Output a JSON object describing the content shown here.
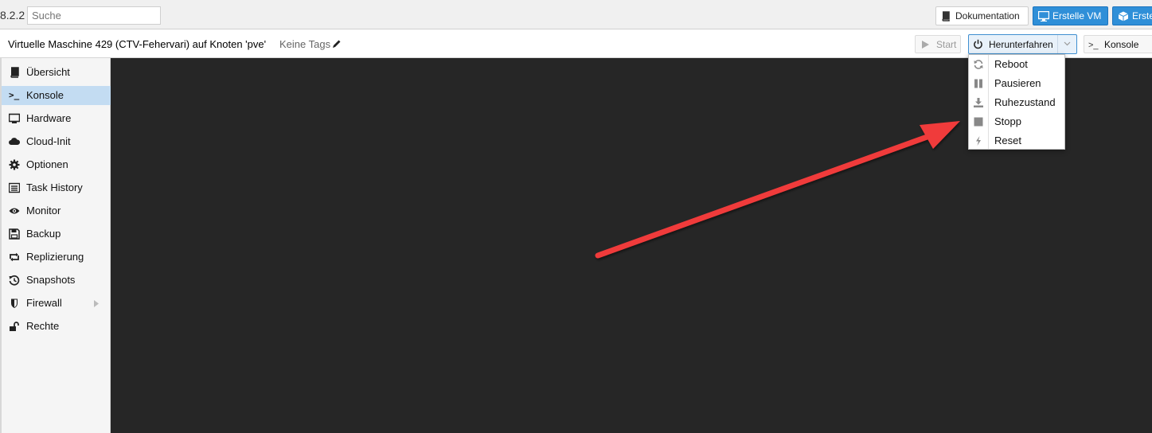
{
  "topbar": {
    "version": "8.2.2",
    "search_placeholder": "Suche",
    "doc_label": "Dokumentation",
    "create_vm_label": "Erstelle VM",
    "create_ct_label": "Erste"
  },
  "header": {
    "vm_title": "Virtuelle Maschine 429 (CTV-Fehervari) auf Knoten 'pve'",
    "tags_label": "Keine Tags",
    "start_label": "Start",
    "shutdown_label": "Herunterfahren",
    "console_label": "Konsole",
    "console_icon_text": ">_"
  },
  "sidebar": {
    "items": [
      {
        "label": "Übersicht",
        "icon": "book-icon"
      },
      {
        "label": "Konsole",
        "icon": "terminal-icon",
        "active": true
      },
      {
        "label": "Hardware",
        "icon": "monitor-icon"
      },
      {
        "label": "Cloud-Init",
        "icon": "cloud-icon"
      },
      {
        "label": "Optionen",
        "icon": "gear-icon"
      },
      {
        "label": "Task History",
        "icon": "list-icon"
      },
      {
        "label": "Monitor",
        "icon": "eye-icon"
      },
      {
        "label": "Backup",
        "icon": "floppy-icon"
      },
      {
        "label": "Replizierung",
        "icon": "retweet-icon"
      },
      {
        "label": "Snapshots",
        "icon": "history-icon"
      },
      {
        "label": "Firewall",
        "icon": "shield-icon"
      },
      {
        "label": "Rechte",
        "icon": "unlock-icon"
      }
    ],
    "terminal_glyph": ">_"
  },
  "shutdown_menu": {
    "items": [
      {
        "label": "Reboot",
        "icon": "refresh-icon"
      },
      {
        "label": "Pausieren",
        "icon": "pause-icon"
      },
      {
        "label": "Ruhezustand",
        "icon": "download-icon"
      },
      {
        "label": "Stopp",
        "icon": "stop-icon"
      },
      {
        "label": "Reset",
        "icon": "bolt-icon"
      }
    ]
  },
  "colors": {
    "accent": "#2f8fd8",
    "console_bg": "#262626",
    "active_nav": "#c3dcf2",
    "annotation_arrow": "#f03a3a"
  }
}
